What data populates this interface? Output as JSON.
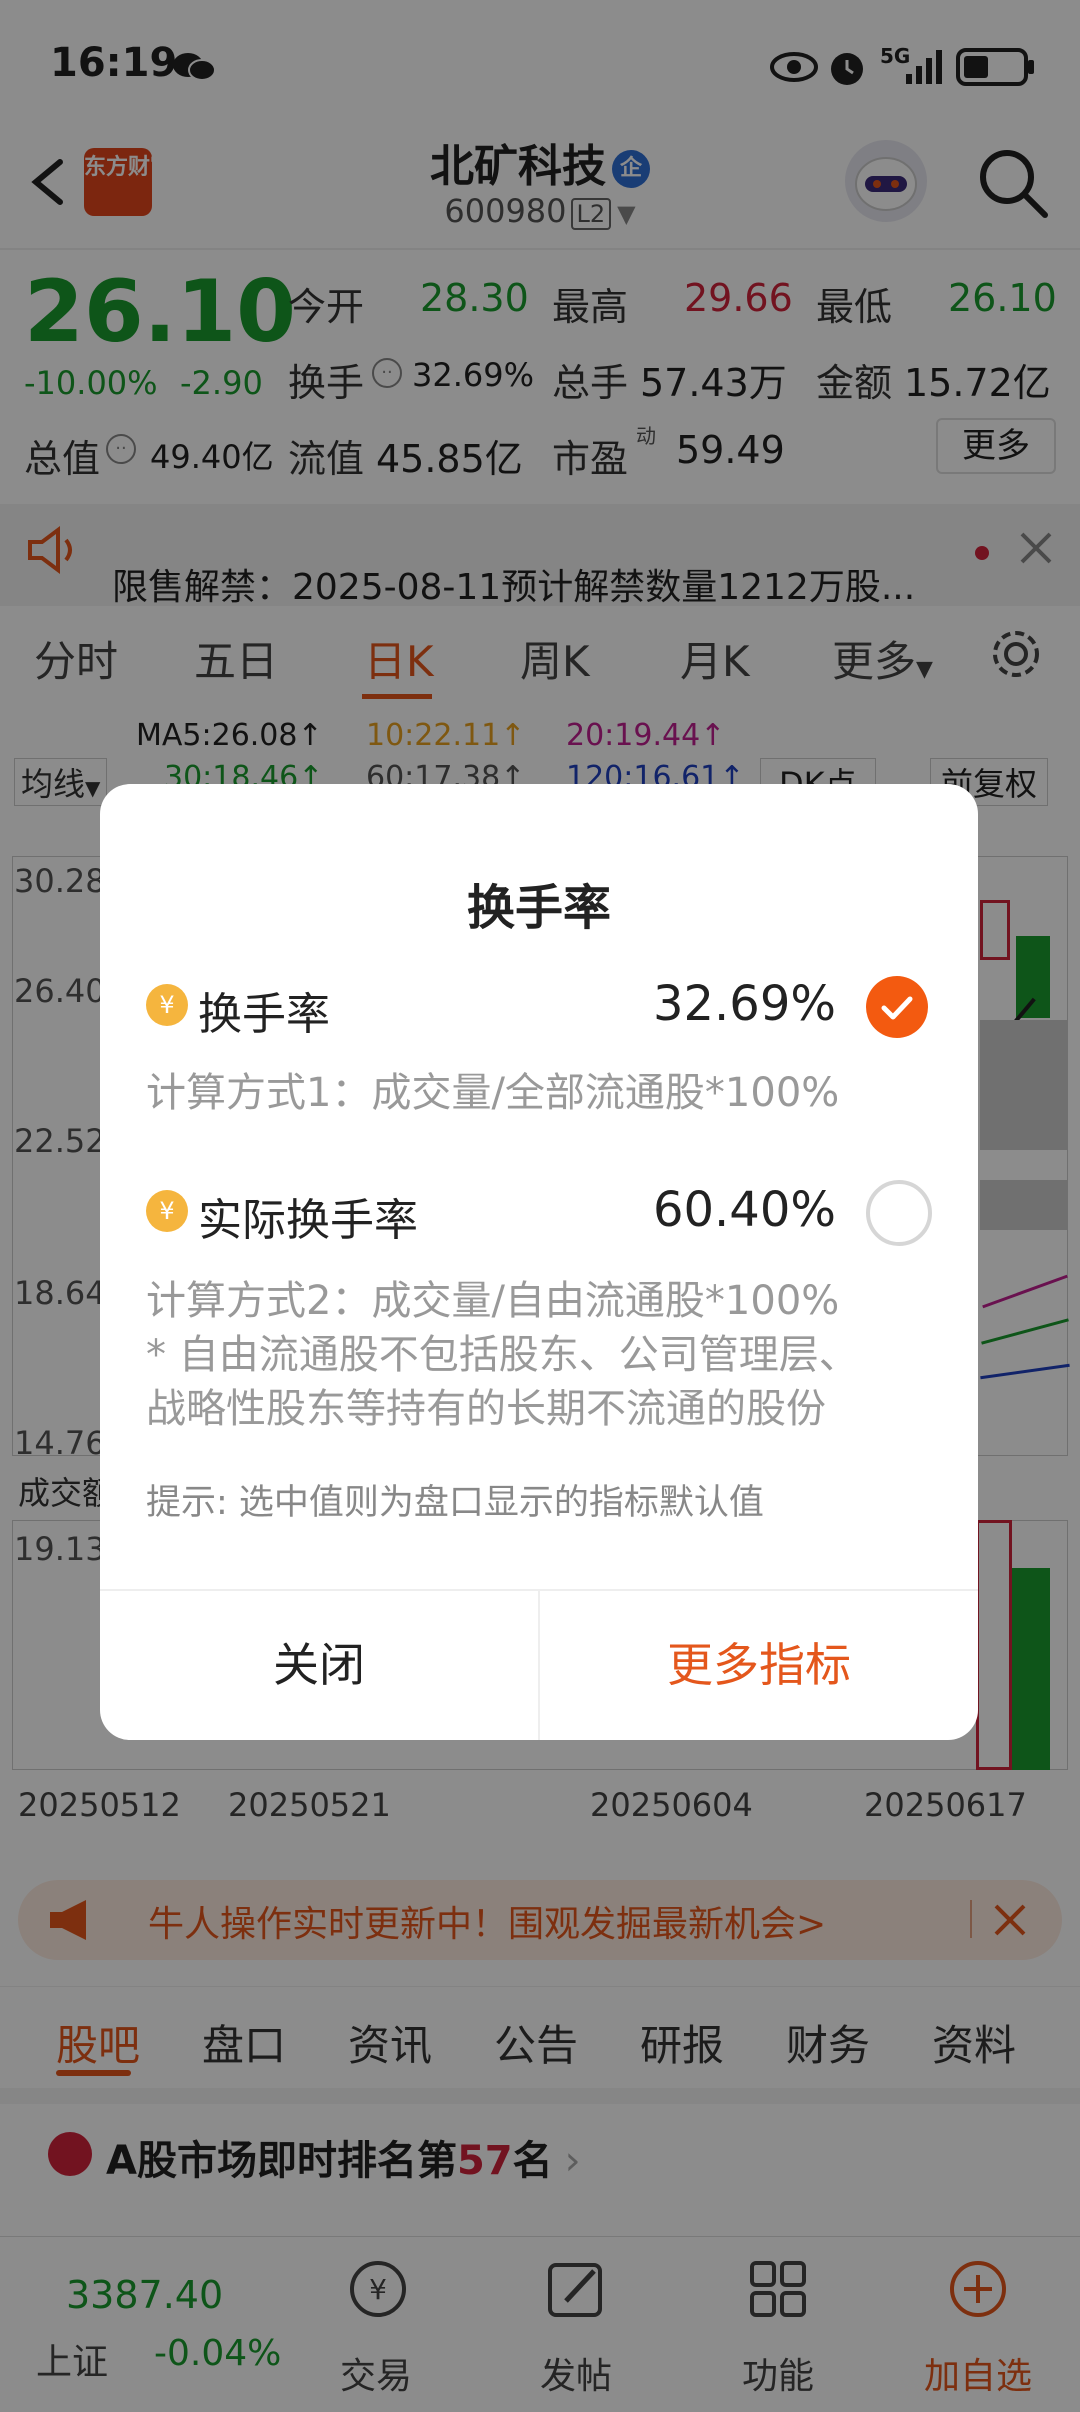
{
  "status_bar": {
    "time": "16:19",
    "network": "5G"
  },
  "header": {
    "logo_text": "东方财富",
    "title": "北矿科技",
    "badge": "企",
    "code": "600980",
    "level": "L2"
  },
  "quote": {
    "price": "26.10",
    "change_pct": "-10.00%",
    "change_amt": "-2.90",
    "open_label": "今开",
    "open": "28.30",
    "high_label": "最高",
    "high": "29.66",
    "low_label": "最低",
    "low": "26.10",
    "turnover_label": "换手",
    "turnover": "32.69%",
    "volume_label": "总手",
    "volume": "57.43万",
    "amount_label": "金额",
    "amount": "15.72亿",
    "mcap_label": "总值",
    "mcap": "49.40亿",
    "float_label": "流值",
    "float": "45.85亿",
    "pe_label": "市盈",
    "pe_sup": "动",
    "pe": "59.49",
    "more": "更多"
  },
  "notice": {
    "text": "限售解禁：2025-08-11预计解禁数量1212万股..."
  },
  "kline_tabs": [
    "分时",
    "五日",
    "日K",
    "周K",
    "月K",
    "更多"
  ],
  "chart": {
    "ma_line1": "MA5:26.08↑",
    "ma_line1b": "10:22.11↑",
    "ma_line1c": "20:19.44↑",
    "ma_line2": "30:18.46↑",
    "ma_line2b": "60:17.38↑",
    "ma_line2c": "120:16.61↑",
    "ma_select": "均线",
    "dk": "DK点",
    "adjust": "前复权",
    "y_labels": [
      "30.28",
      "26.40",
      "22.52",
      "18.64",
      "14.76"
    ],
    "volume_label": "成交额",
    "volume_max": "19.13",
    "dates": [
      "20250512",
      "20250521",
      "20250604",
      "20250617"
    ]
  },
  "banner": {
    "text": "牛人操作实时更新中！围观发掘最新机会>"
  },
  "sub_tabs": [
    "股吧",
    "盘口",
    "资讯",
    "公告",
    "研报",
    "财务",
    "资料"
  ],
  "rank": {
    "prefix": "A股市场即时排名第",
    "number": "57",
    "suffix": "名"
  },
  "bottom_nav": {
    "index_value": "3387.40",
    "index_name": "上证",
    "index_change": "-0.04%",
    "items": [
      "交易",
      "发帖",
      "功能",
      "加自选"
    ]
  },
  "dialog": {
    "title": "换手率",
    "option1_label": "换手率",
    "option1_value": "32.69%",
    "option1_desc": "计算方式1：成交量/全部流通股*100%",
    "option2_label": "实际换手率",
    "option2_value": "60.40%",
    "option2_desc1": "计算方式2：成交量/自由流通股*100%",
    "option2_desc2": " * 自由流通股不包括股东、公司管理层、",
    "option2_desc3": "战略性股东等持有的长期不流通的股份",
    "tip": "提示: 选中值则为盘口显示的指标默认值",
    "close_btn": "关闭",
    "more_btn": "更多指标"
  },
  "colors": {
    "accent": "#e4571c",
    "up": "#d0233b",
    "down": "#1a9b2e"
  }
}
